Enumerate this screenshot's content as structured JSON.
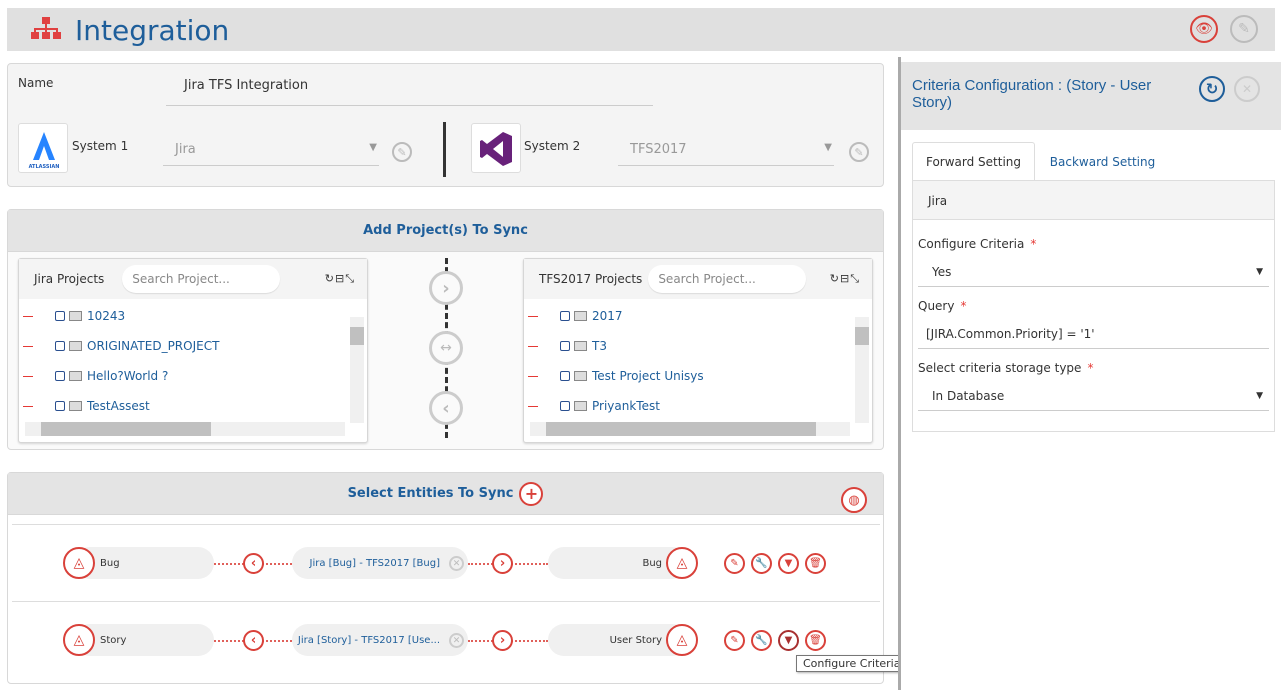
{
  "header": {
    "title": "Integration",
    "icon": "sitemap-icon"
  },
  "details": {
    "name_label": "Name",
    "name_value": "Jira TFS Integration",
    "system1_label": "System 1",
    "system1_value": "Jira",
    "system1_logo": "ATLASSIAN",
    "system2_label": "System 2",
    "system2_value": "TFS2017"
  },
  "projects": {
    "title": "Add Project(s) To Sync",
    "left": {
      "title": "Jira Projects",
      "placeholder": "Search Project...",
      "items": [
        "10243",
        "ORIGINATED_PROJECT",
        "Hello?World ?",
        "TestAssest"
      ]
    },
    "right": {
      "title": "TFS2017 Projects",
      "placeholder": "Search Project...",
      "items": [
        "2017",
        "T3",
        "Test Project Unisys",
        "PriyankTest"
      ]
    }
  },
  "entities": {
    "title": "Select Entities To Sync",
    "rows": [
      {
        "left": "Bug",
        "mapping": "Jira [Bug] - TFS2017 [Bug]",
        "right": "Bug"
      },
      {
        "left": "Story",
        "mapping": "Jira [Story] - TFS2017 [Use...",
        "right": "User Story"
      }
    ],
    "tooltip": "Configure Criteria"
  },
  "criteria": {
    "title": "Criteria Configuration : (Story - User Story)",
    "tabs": [
      "Forward Setting",
      "Backward Setting"
    ],
    "section": "Jira",
    "fields": [
      {
        "label": "Configure Criteria",
        "value": "Yes",
        "required": "*"
      },
      {
        "label": "Query",
        "value": "[JIRA.Common.Priority] = '1'",
        "required": "*"
      },
      {
        "label": "Select criteria storage type",
        "value": "In Database",
        "required": "*"
      }
    ]
  },
  "colors": {
    "accent": "#d9413a",
    "blue": "#1e5e9a"
  }
}
